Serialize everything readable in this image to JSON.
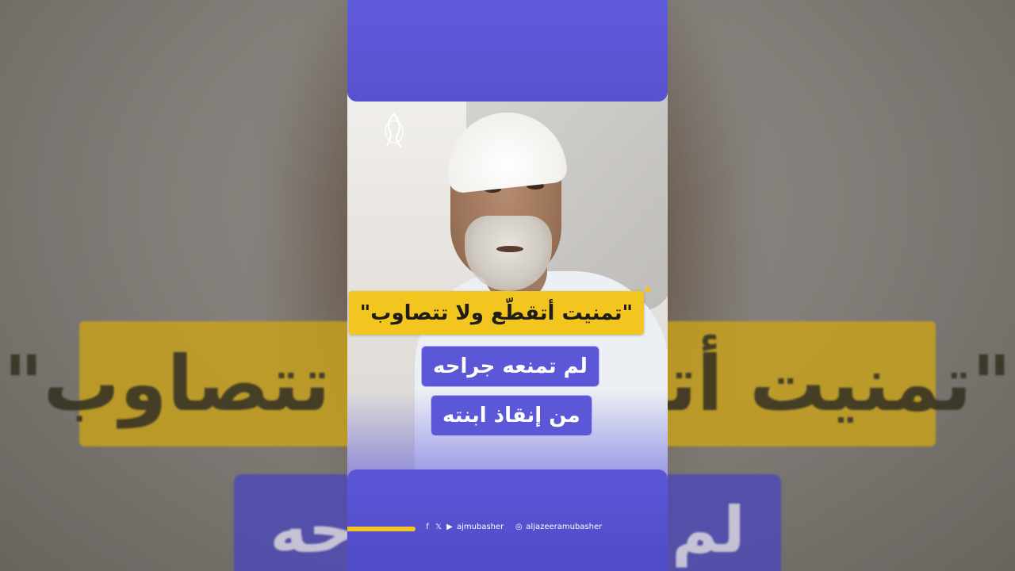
{
  "quote": "\"تمنيت أتقطّع ولا تتصاوب\"",
  "line1": "لم تمنعه جراحه",
  "line2": "من إنقاذ ابنته",
  "background_quote": "\"تمنيت أتقطّع ولا تتصاوب\"",
  "background_line": "لم تمنعه جراحه",
  "social": {
    "handle1": "ajmubasher",
    "handle2": "aljazeeramubasher",
    "icons": [
      "facebook-icon",
      "x-icon",
      "youtube-icon",
      "instagram-icon"
    ]
  },
  "colors": {
    "accent_yellow": "#f3c61f",
    "brand_purple": "#5b57d6"
  }
}
